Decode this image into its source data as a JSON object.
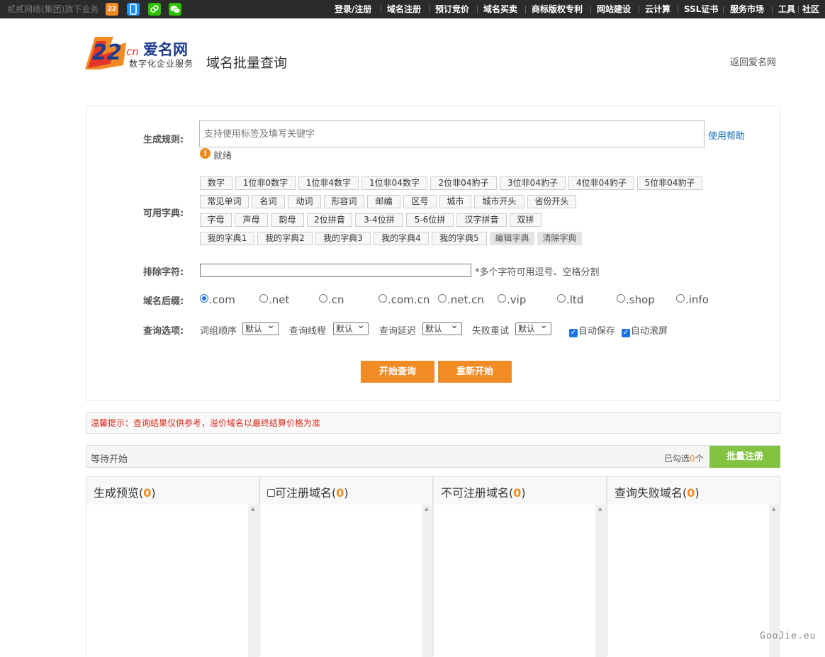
{
  "topbar": {
    "group_text": "贰贰网络(集团)旗下业务",
    "nav": [
      "登录/注册",
      "域名注册",
      "预订竞价",
      "域名买卖",
      "商标版权专利",
      "网站建设",
      "云计算",
      "SSL证书",
      "服务市场",
      "工具",
      "社区"
    ]
  },
  "logo": {
    "mark": "22",
    "suffix": "cn",
    "name": "爱名网",
    "slogan": "数字化企业服务"
  },
  "page_title": "域名批量查询",
  "back_link": "返回爱名网",
  "form": {
    "rule_label": "生成规则:",
    "rule_placeholder": "支持使用标签及填写关键字",
    "help_link": "使用帮助",
    "status": "就绪",
    "dict_label": "可用字典:",
    "dict_rows": [
      [
        "数字",
        "1位非0数字",
        "1位非4数字",
        "1位非04数字",
        "2位非04豹子",
        "3位非04豹子",
        "4位非04豹子",
        "5位非04豹子"
      ],
      [
        "常见单词",
        "名词",
        "动词",
        "形容词",
        "邮编",
        "区号",
        "城市",
        "城市开头",
        "省份开头"
      ],
      [
        "字母",
        "声母",
        "韵母",
        "2位拼音",
        "3-4位拼",
        "5-6位拼",
        "汉字拼音",
        "双拼"
      ],
      [
        "我的字典1",
        "我的字典2",
        "我的字典3",
        "我的字典4",
        "我的字典5",
        "编辑字典",
        "清除字典"
      ]
    ],
    "exclude_label": "排除字符:",
    "exclude_hint": "*多个字符可用逗号、空格分割",
    "suffix_label": "域名后缀:",
    "suffixes": [
      ".com",
      ".net",
      ".cn",
      ".com.cn",
      ".net.cn",
      ".vip",
      ".ltd",
      ".shop",
      ".info"
    ],
    "selected_suffix": ".com",
    "options_label": "查询选项:",
    "options": [
      {
        "label": "词组顺序",
        "value": "默认"
      },
      {
        "label": "查询线程",
        "value": "默认"
      },
      {
        "label": "查询延迟",
        "value": "默认"
      },
      {
        "label": "失败重试",
        "value": "默认"
      }
    ],
    "checkboxes": [
      {
        "label": "自动保存",
        "checked": true
      },
      {
        "label": "自动滚屏",
        "checked": true
      }
    ],
    "start_button": "开始查询",
    "restart_button": "重新开始"
  },
  "tip": "温馨提示：查询结果仅供参考，溢价域名以最终结算价格为准",
  "status_bar": {
    "left": "等待开始",
    "selected_prefix": "已勾选",
    "selected_count": "0",
    "selected_suffix": "个",
    "batch_button": "批量注册"
  },
  "columns": [
    {
      "title": "生成预览",
      "count": "0"
    },
    {
      "title": "可注册域名",
      "count": "0"
    },
    {
      "title": "不可注册域名",
      "count": "0"
    },
    {
      "title": "查询失败域名",
      "count": "0"
    }
  ],
  "watermark": "GooJie.eu",
  "colors": {
    "accent_orange": "#f28b24",
    "batch_green": "#82c341",
    "tip_red": "#d9291c",
    "link_blue": "#1a6cbf"
  }
}
